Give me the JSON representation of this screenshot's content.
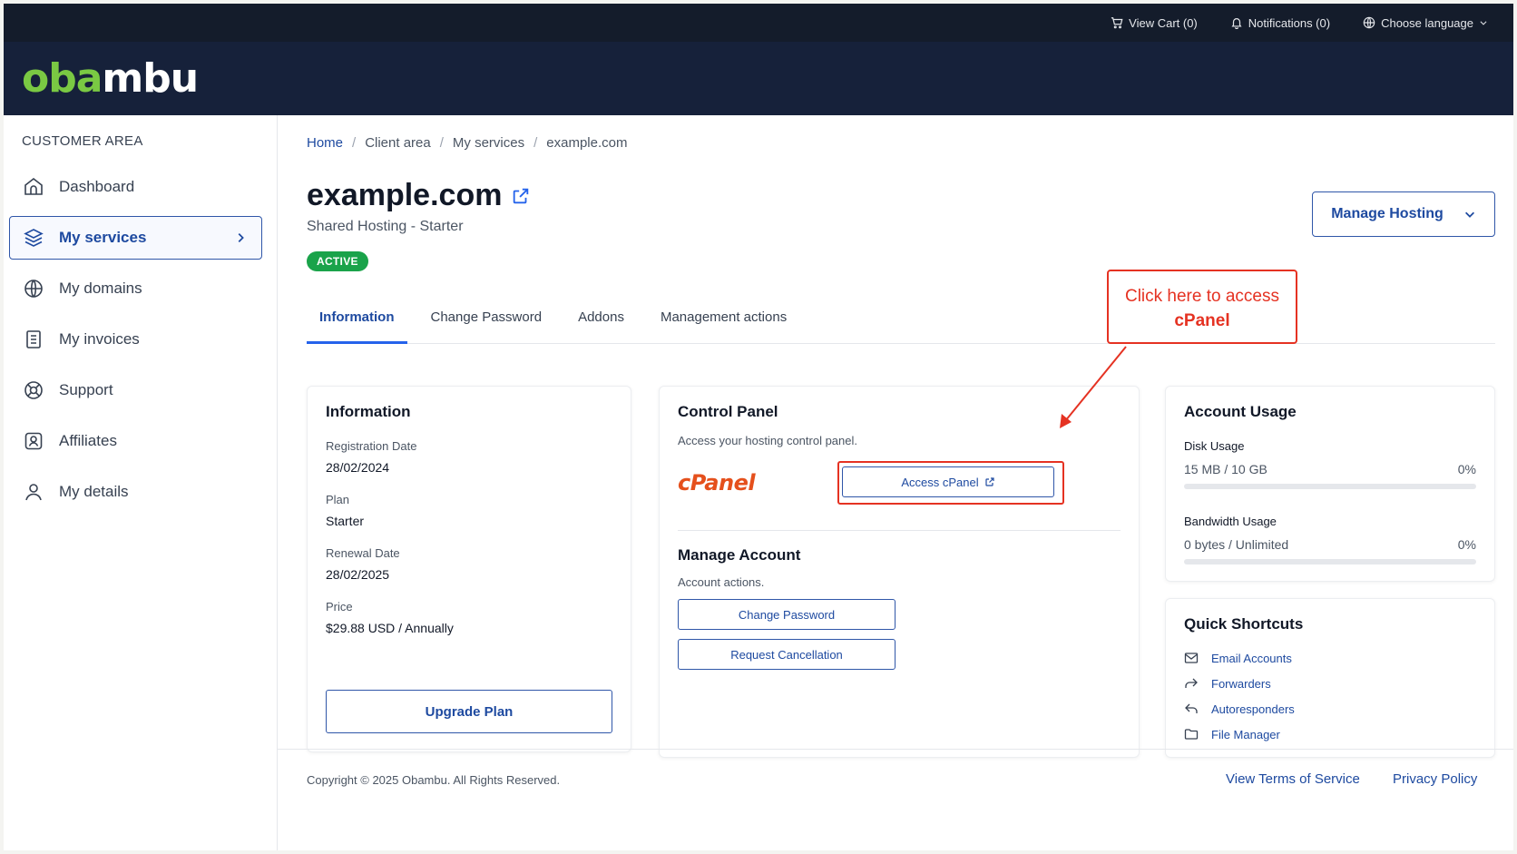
{
  "topbar": {
    "cart": "View Cart (0)",
    "notifications": "Notifications (0)",
    "language": "Choose language"
  },
  "brand": {
    "logo_green": "oba",
    "logo_white": "mbu",
    "green_color": "#7ac943"
  },
  "sidebar": {
    "heading": "CUSTOMER AREA",
    "items": [
      {
        "label": "Dashboard",
        "icon": "home-icon"
      },
      {
        "label": "My services",
        "icon": "layers-icon",
        "active": true
      },
      {
        "label": "My domains",
        "icon": "globe-icon"
      },
      {
        "label": "My invoices",
        "icon": "document-icon"
      },
      {
        "label": "Support",
        "icon": "lifebuoy-icon"
      },
      {
        "label": "Affiliates",
        "icon": "affiliate-badge-icon"
      },
      {
        "label": "My details",
        "icon": "user-icon"
      }
    ]
  },
  "breadcrumb": [
    "Home",
    "Client area",
    "My services",
    "example.com"
  ],
  "service": {
    "title": "example.com",
    "subtitle": "Shared Hosting - Starter",
    "status": "ACTIVE"
  },
  "manage_button": "Manage Hosting",
  "tabs": [
    "Information",
    "Change Password",
    "Addons",
    "Management actions"
  ],
  "info": {
    "title": "Information",
    "fields": [
      {
        "label": "Registration Date",
        "value": "28/02/2024"
      },
      {
        "label": "Plan",
        "value": "Starter"
      },
      {
        "label": "Renewal Date",
        "value": "28/02/2025"
      },
      {
        "label": "Price",
        "value": "$29.88 USD / Annually"
      }
    ],
    "upgrade": "Upgrade Plan"
  },
  "control_panel": {
    "title": "Control Panel",
    "description": "Access your hosting control panel.",
    "logo_text": "cPanel",
    "access_button": "Access cPanel"
  },
  "manage_account": {
    "title": "Manage Account",
    "description": "Account actions.",
    "buttons": [
      "Change Password",
      "Request Cancellation"
    ]
  },
  "usage": {
    "title": "Account Usage",
    "disk": {
      "label": "Disk Usage",
      "value": "15 MB / 10 GB",
      "percent": "0%"
    },
    "bandwidth": {
      "label": "Bandwidth Usage",
      "value": "0 bytes / Unlimited",
      "percent": "0%"
    }
  },
  "shortcuts": {
    "title": "Quick Shortcuts",
    "items": [
      {
        "label": "Email Accounts",
        "icon": "mail-icon"
      },
      {
        "label": "Forwarders",
        "icon": "forward-icon"
      },
      {
        "label": "Autoresponders",
        "icon": "reply-icon"
      },
      {
        "label": "File Manager",
        "icon": "folder-icon"
      }
    ]
  },
  "callout": {
    "line1": "Click here to access",
    "line2": "cPanel",
    "color": "#e53222"
  },
  "footer": {
    "copyright": "Copyright © 2025 Obambu. All Rights Reserved.",
    "terms": "View Terms of Service",
    "privacy": "Privacy Policy"
  }
}
